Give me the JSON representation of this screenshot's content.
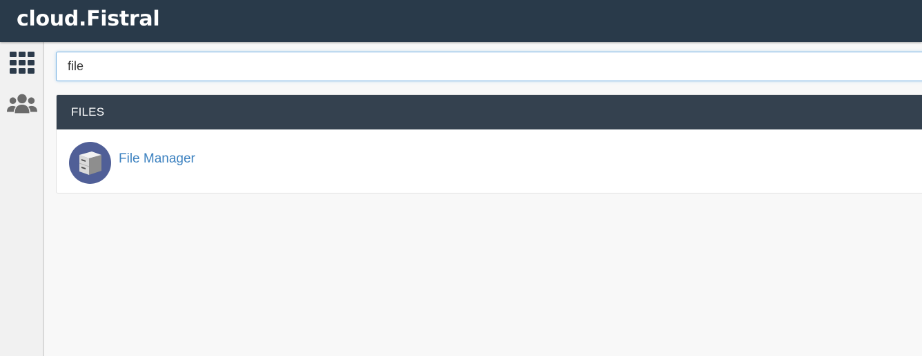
{
  "header": {
    "brand": "cloud.Fistral"
  },
  "sidebar": {
    "items": [
      {
        "icon": "grid-icon",
        "name": "tools"
      },
      {
        "icon": "users-icon",
        "name": "users"
      }
    ]
  },
  "search": {
    "value": "file",
    "placeholder": ""
  },
  "results": {
    "groups": [
      {
        "title": "FILES",
        "items": [
          {
            "label": "File Manager",
            "icon": "file-cabinet-icon"
          }
        ]
      }
    ]
  },
  "colors": {
    "header_bg": "#293a4a",
    "panel_header_bg": "#34414f",
    "link": "#3d82c0",
    "icon_circle": "#505f97"
  }
}
